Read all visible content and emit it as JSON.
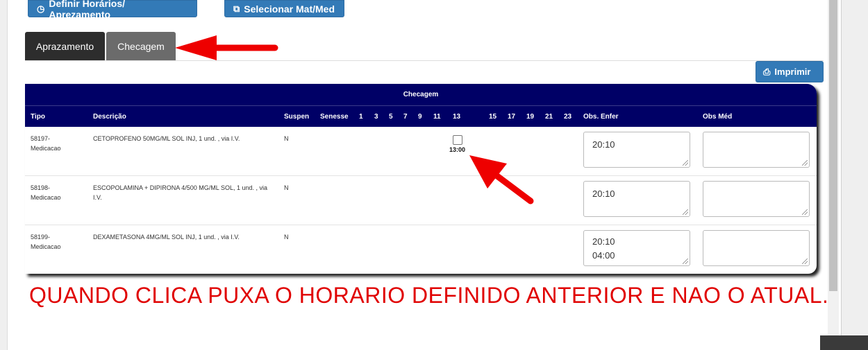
{
  "toolbar": {
    "definir_label": "Definir Horários/ Aprezamento",
    "selecionar_label": "Selecionar Mat/Med",
    "imprimir_label": "Imprimir"
  },
  "tabs": [
    {
      "label": "Aprazamento"
    },
    {
      "label": "Checagem"
    }
  ],
  "table": {
    "title": "Checagem",
    "columns": {
      "tipo": "Tipo",
      "descricao": "Descrição",
      "suspen": "Suspen",
      "senesse": "Senesse",
      "hours": [
        "1",
        "3",
        "5",
        "7",
        "9",
        "11",
        "13",
        "15",
        "17",
        "19",
        "21",
        "23"
      ],
      "obs_enfer": "Obs. Enfer",
      "obs_med": "Obs Méd"
    },
    "rows": [
      {
        "tipo": "58197-\nMedicacao",
        "descricao": "CETOPROFENO 50MG/ML SOL INJ, 1 und. , via I.V.",
        "suspen": "N",
        "check_time": "13:00",
        "obs_enfer": "20:10",
        "obs_med": ""
      },
      {
        "tipo": "58198-\nMedicacao",
        "descricao": "ESCOPOLAMINA + DIPIRONA 4/500 MG/ML SOL, 1 und. , via I.V.",
        "suspen": "N",
        "obs_enfer": "20:10",
        "obs_med": ""
      },
      {
        "tipo": "58199-\nMedicacao",
        "descricao": "DEXAMETASONA 4MG/ML SOL INJ, 1 und. , via I.V.",
        "suspen": "N",
        "obs_enfer": "20:10\n04:00",
        "obs_med": ""
      }
    ]
  },
  "annotation": {
    "note": "QUANDO CLICA PUXA O HORARIO DEFINIDO ANTERIOR E NAO O ATUAL.",
    "color": "#e00000"
  },
  "colors": {
    "primary_button": "#337ab7",
    "table_header": "#000066",
    "active_tab": "#2d2d2d",
    "inactive_tab": "#6b6b6b"
  }
}
